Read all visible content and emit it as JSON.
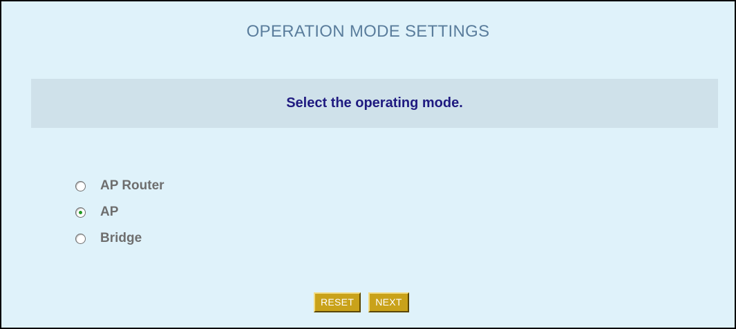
{
  "header": {
    "title": "OPERATION MODE SETTINGS"
  },
  "prompt": {
    "text": "Select the operating mode."
  },
  "modes": [
    {
      "label": "AP Router",
      "selected": false
    },
    {
      "label": "AP",
      "selected": true
    },
    {
      "label": "Bridge",
      "selected": false
    }
  ],
  "buttons": {
    "reset_label": "RESET",
    "next_label": "NEXT"
  },
  "colors": {
    "background": "#dff2fa",
    "band": "#cfe1ea",
    "title": "#5a7d9c",
    "prompt": "#1f1a80",
    "button": "#c9a21a",
    "radio_dot": "#229922"
  }
}
